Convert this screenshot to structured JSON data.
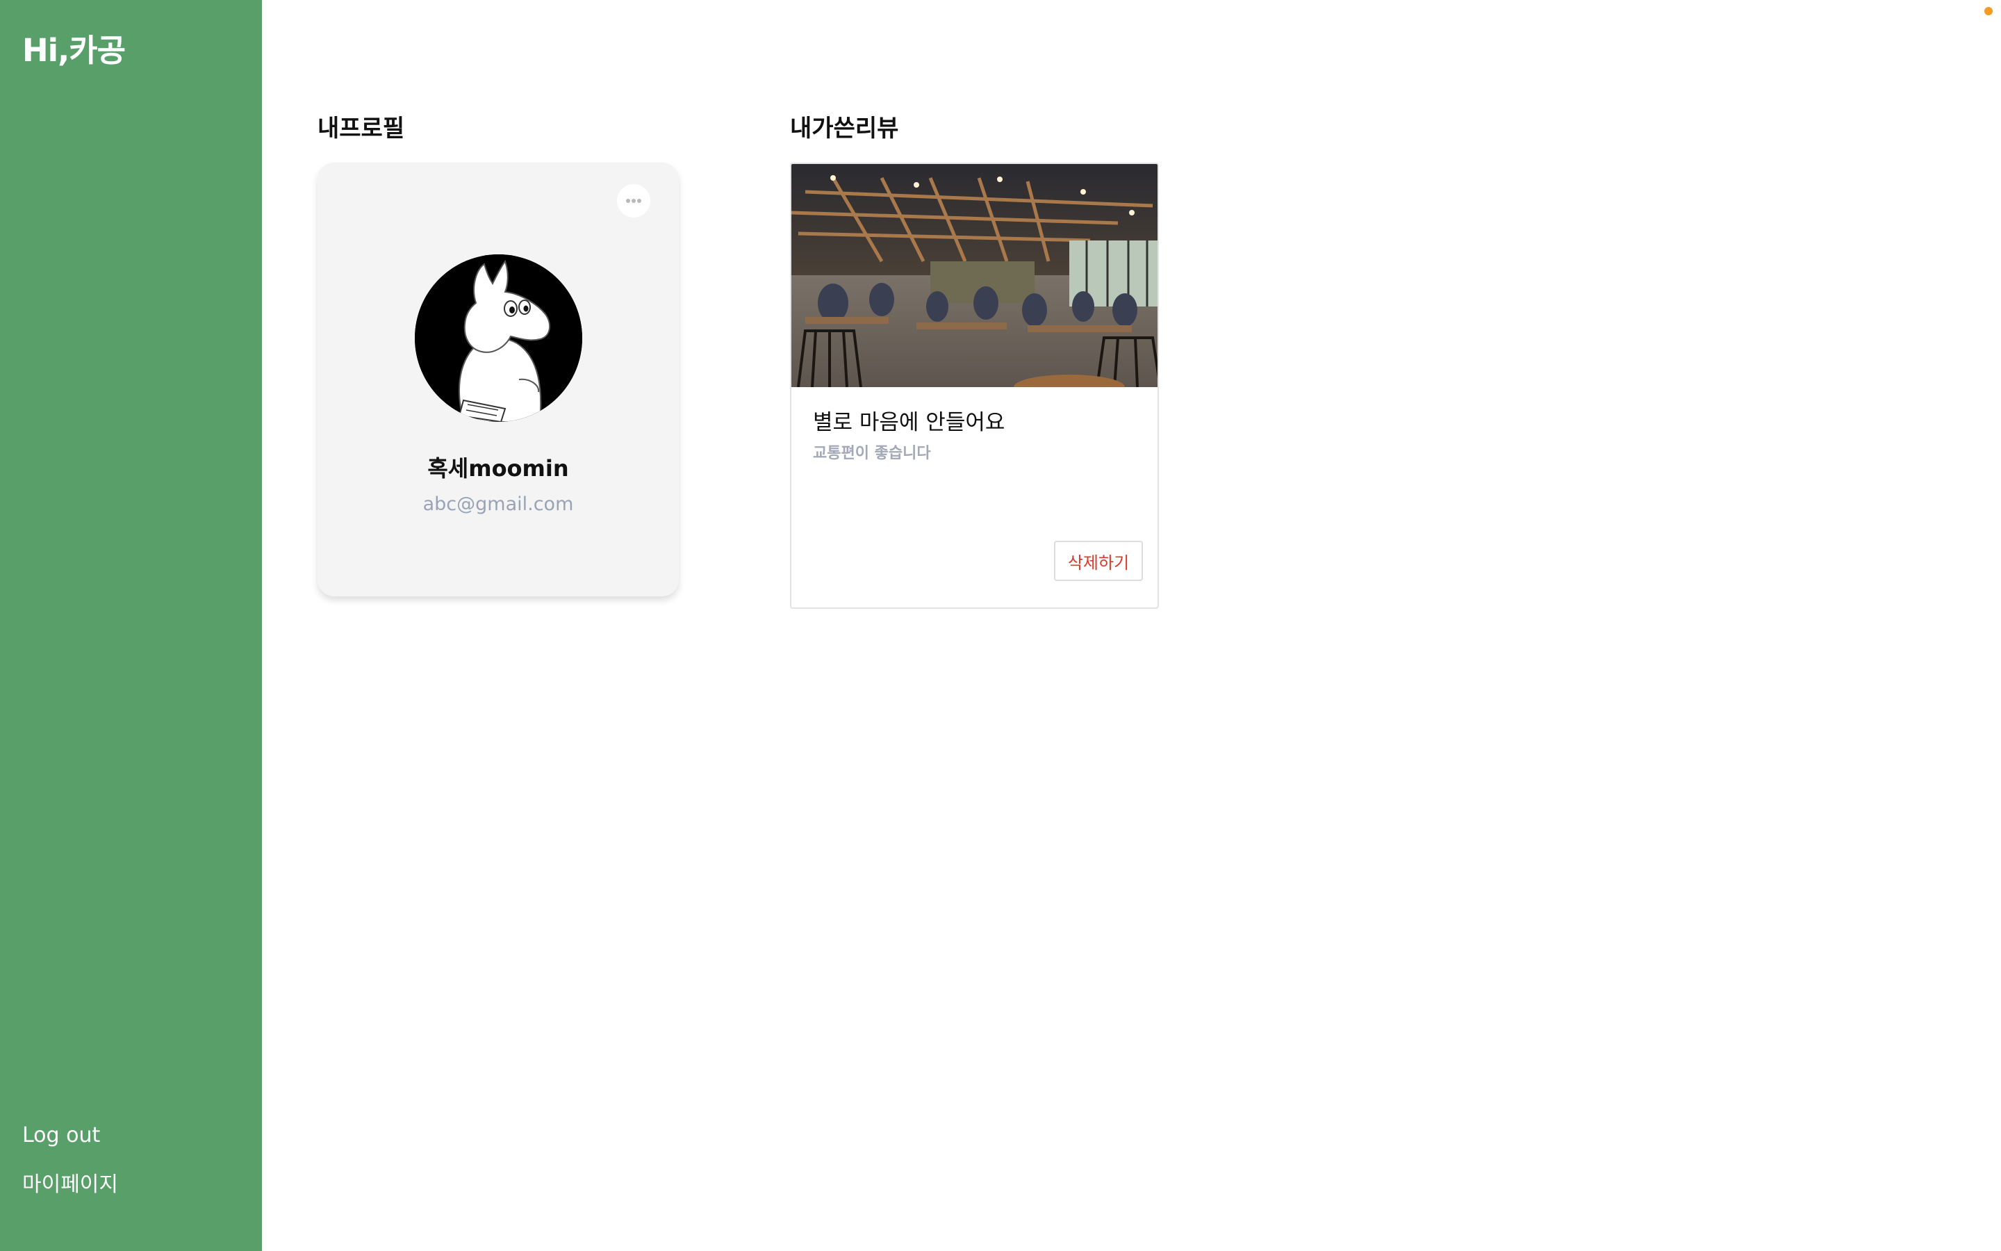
{
  "brand": {
    "title": "Hi,카공"
  },
  "sidebar": {
    "items": [
      {
        "label": "Log out"
      },
      {
        "label": "마이페이지"
      }
    ]
  },
  "sections": {
    "profile_title": "내프로필",
    "reviews_title": "내가쓴리뷰"
  },
  "profile": {
    "name": "혹세moomin",
    "email": "abc@gmail.com",
    "more_icon": "more-horizontal-icon",
    "avatar_icon": "moomin-avatar"
  },
  "reviews": [
    {
      "title": "별로 마음에 안들어요",
      "body": "교통편이 좋습니다",
      "delete_label": "삭제하기",
      "photo_icon": "cafe-interior-photo"
    }
  ],
  "colors": {
    "sidebar": "#599f6a",
    "delete_text": "#d83a2e",
    "email_text": "#9aa3b5",
    "card_bg": "#f4f4f4",
    "notification_dot": "#f59a23"
  }
}
